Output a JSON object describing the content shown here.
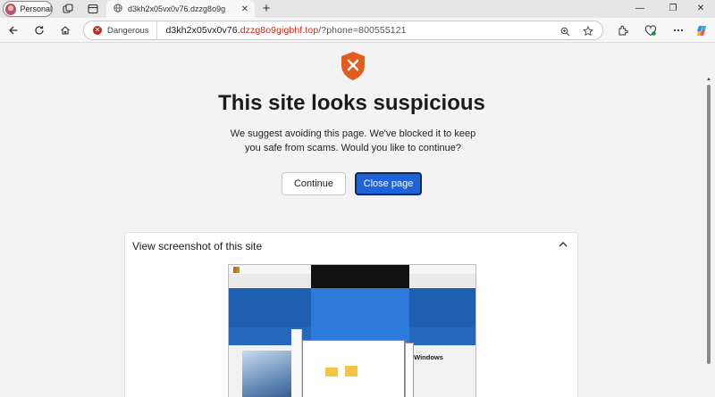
{
  "browser": {
    "profile_label": "Personal",
    "tab_title": "d3kh2x05vx0v76.dzzg8o9g",
    "address": {
      "security_label": "Dangerous",
      "url_prefix": "d3kh2x05vx0v76.",
      "url_domain": "dzzg8o9gigbhf.top",
      "url_path": "/?phone=800555121"
    }
  },
  "page": {
    "headline": "This site looks suspicious",
    "description": "We suggest avoiding this page. We've blocked it to keep you safe from scams. Would you like to continue?",
    "continue_label": "Continue",
    "close_label": "Close page",
    "screenshot_panel_title": "View screenshot of this site",
    "screenshot_text_with_windows": "with Windows"
  },
  "colors": {
    "danger": "#c42b1c",
    "primary_button": "#1f63d8",
    "shield": "#e35c1c"
  },
  "icons": [
    "profile-avatar",
    "workspaces-icon",
    "tab-actions-icon",
    "globe-icon",
    "close-icon",
    "plus-icon",
    "back-arrow-icon",
    "refresh-icon",
    "home-icon",
    "zoom-icon",
    "star-icon",
    "extensions-icon",
    "browser-essentials-icon",
    "copilot-icon",
    "shield-x-icon",
    "chevron-up-icon"
  ]
}
